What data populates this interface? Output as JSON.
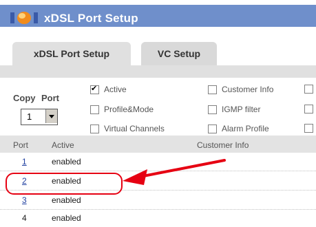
{
  "window": {
    "title": "xDSL Port Setup"
  },
  "tabs": [
    {
      "label": "xDSL Port Setup"
    },
    {
      "label": "VC Setup"
    }
  ],
  "controls": {
    "copy_label": "Copy",
    "port_label": "Port",
    "port_select_value": "1",
    "checkboxes": [
      {
        "label": "Active",
        "checked": true
      },
      {
        "label": "Profile&Mode",
        "checked": false
      },
      {
        "label": "Virtual Channels",
        "checked": false
      },
      {
        "label": "Customer Info",
        "checked": false
      },
      {
        "label": "IGMP filter",
        "checked": false
      },
      {
        "label": "Alarm Profile",
        "checked": false
      }
    ]
  },
  "table": {
    "headers": [
      "Port",
      "Active",
      "Customer Info"
    ],
    "rows": [
      {
        "port": "1",
        "active": "enabled"
      },
      {
        "port": "2",
        "active": "enabled"
      },
      {
        "port": "3",
        "active": "enabled"
      },
      {
        "port": "4",
        "active": "enabled"
      }
    ]
  },
  "colors": {
    "titlebar": "#6f8fcb",
    "tab_bg": "#d9d9d9",
    "header_bg": "#e3e3e3",
    "link": "#1f3fa0",
    "annotation": "#e60012"
  },
  "icons": [
    "window-logo-icon",
    "checkbox-icon",
    "dropdown-arrow-icon",
    "annotation-arrow"
  ]
}
